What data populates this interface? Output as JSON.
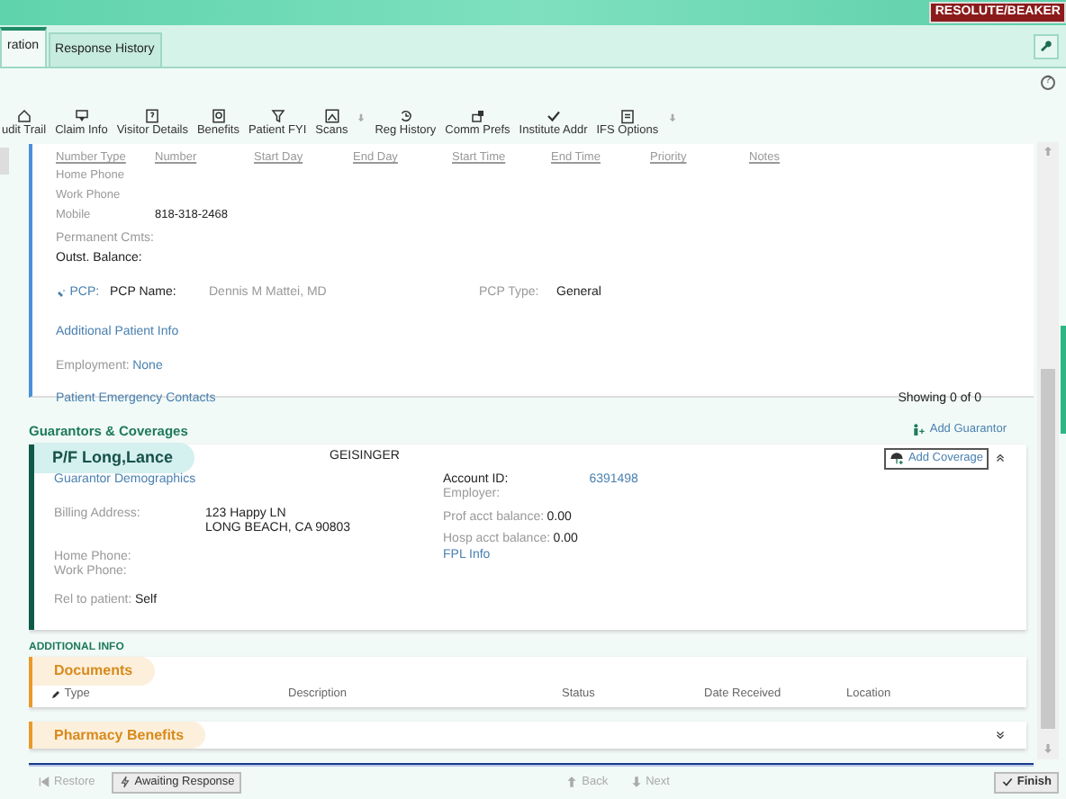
{
  "banner": {
    "environment": "RESOLUTE/BEAKER"
  },
  "tabs": [
    {
      "label": "ration",
      "selected": true
    },
    {
      "label": "Response History",
      "selected": false
    }
  ],
  "help": "?",
  "toolbar": [
    {
      "label": "udit Trail",
      "dropdown": false
    },
    {
      "label": "Claim Info",
      "dropdown": false
    },
    {
      "label": "Visitor Details",
      "dropdown": false
    },
    {
      "label": "Benefits",
      "dropdown": false
    },
    {
      "label": "Patient FYI",
      "dropdown": false
    },
    {
      "label": "Scans",
      "dropdown": true
    },
    {
      "label": "Reg History",
      "dropdown": false
    },
    {
      "label": "Comm Prefs",
      "dropdown": false
    },
    {
      "label": "Institute Addr",
      "dropdown": false
    },
    {
      "label": "IFS Options",
      "dropdown": true
    }
  ],
  "phones": {
    "columns": [
      "Number Type",
      "Number",
      "Start Day",
      "End Day",
      "Start Time",
      "End Time",
      "Priority",
      "Notes"
    ],
    "rows": [
      {
        "type": "Home Phone"
      },
      {
        "type": "Work Phone"
      },
      {
        "type": "Mobile",
        "number": "818-318-2468"
      }
    ]
  },
  "patient": {
    "permanent_cmts": "Permanent Cmts:",
    "outst_balance": "Outst. Balance:",
    "pcp": "PCP:",
    "pcp_name_label": "PCP Name:",
    "pcp_name": "Dennis M Mattei, MD",
    "pcp_type_label": "PCP Type:",
    "pcp_type": "General",
    "additional_link": "Additional Patient Info",
    "employment_label": "Employment:",
    "employment": "None",
    "emergency_link": "Patient Emergency Contacts",
    "showing": "Showing 0 of 0"
  },
  "guarantors": {
    "title": "Guarantors & Coverages",
    "add_guarantor": "Add Guarantor",
    "cards": [
      {
        "name": "P/F Long,Lance",
        "payer": "GEISINGER",
        "expanded": true,
        "add_coverage": "Add Coverage",
        "demographics_link": "Guarantor Demographics",
        "billing_label": "Billing Address:",
        "billing_lines": [
          "123 Happy LN",
          "LONG BEACH, CA 90803"
        ],
        "home_phone_label": "Home Phone:",
        "work_phone_label": "Work Phone:",
        "rel_label": "Rel to patient:",
        "rel": "Self",
        "account_label": "Account ID:",
        "account": "6391498",
        "employer_label": "Employer:",
        "prof_label": "Prof acct balance:",
        "prof": "0.00",
        "hosp_label": "Hosp acct balance:",
        "hosp": "0.00",
        "fpl_link": "FPL Info"
      }
    ]
  },
  "additional_info": {
    "title": "ADDITIONAL INFO",
    "sections": [
      {
        "title": "Documents",
        "expanded": true,
        "columns": [
          "Type",
          "Description",
          "Status",
          "Date Received",
          "Location"
        ]
      },
      {
        "title": "Pharmacy Benefits",
        "expanded": false
      }
    ]
  },
  "footer": [
    {
      "label": "Restore",
      "kind": "plain",
      "disabled": true
    },
    {
      "label": "Awaiting Response",
      "kind": "boxed",
      "disabled": false
    },
    {
      "label": "Back",
      "kind": "plain",
      "disabled": true
    },
    {
      "label": "Next",
      "kind": "plain",
      "disabled": true
    },
    {
      "label": "Finish",
      "kind": "boxed",
      "disabled": false
    }
  ]
}
